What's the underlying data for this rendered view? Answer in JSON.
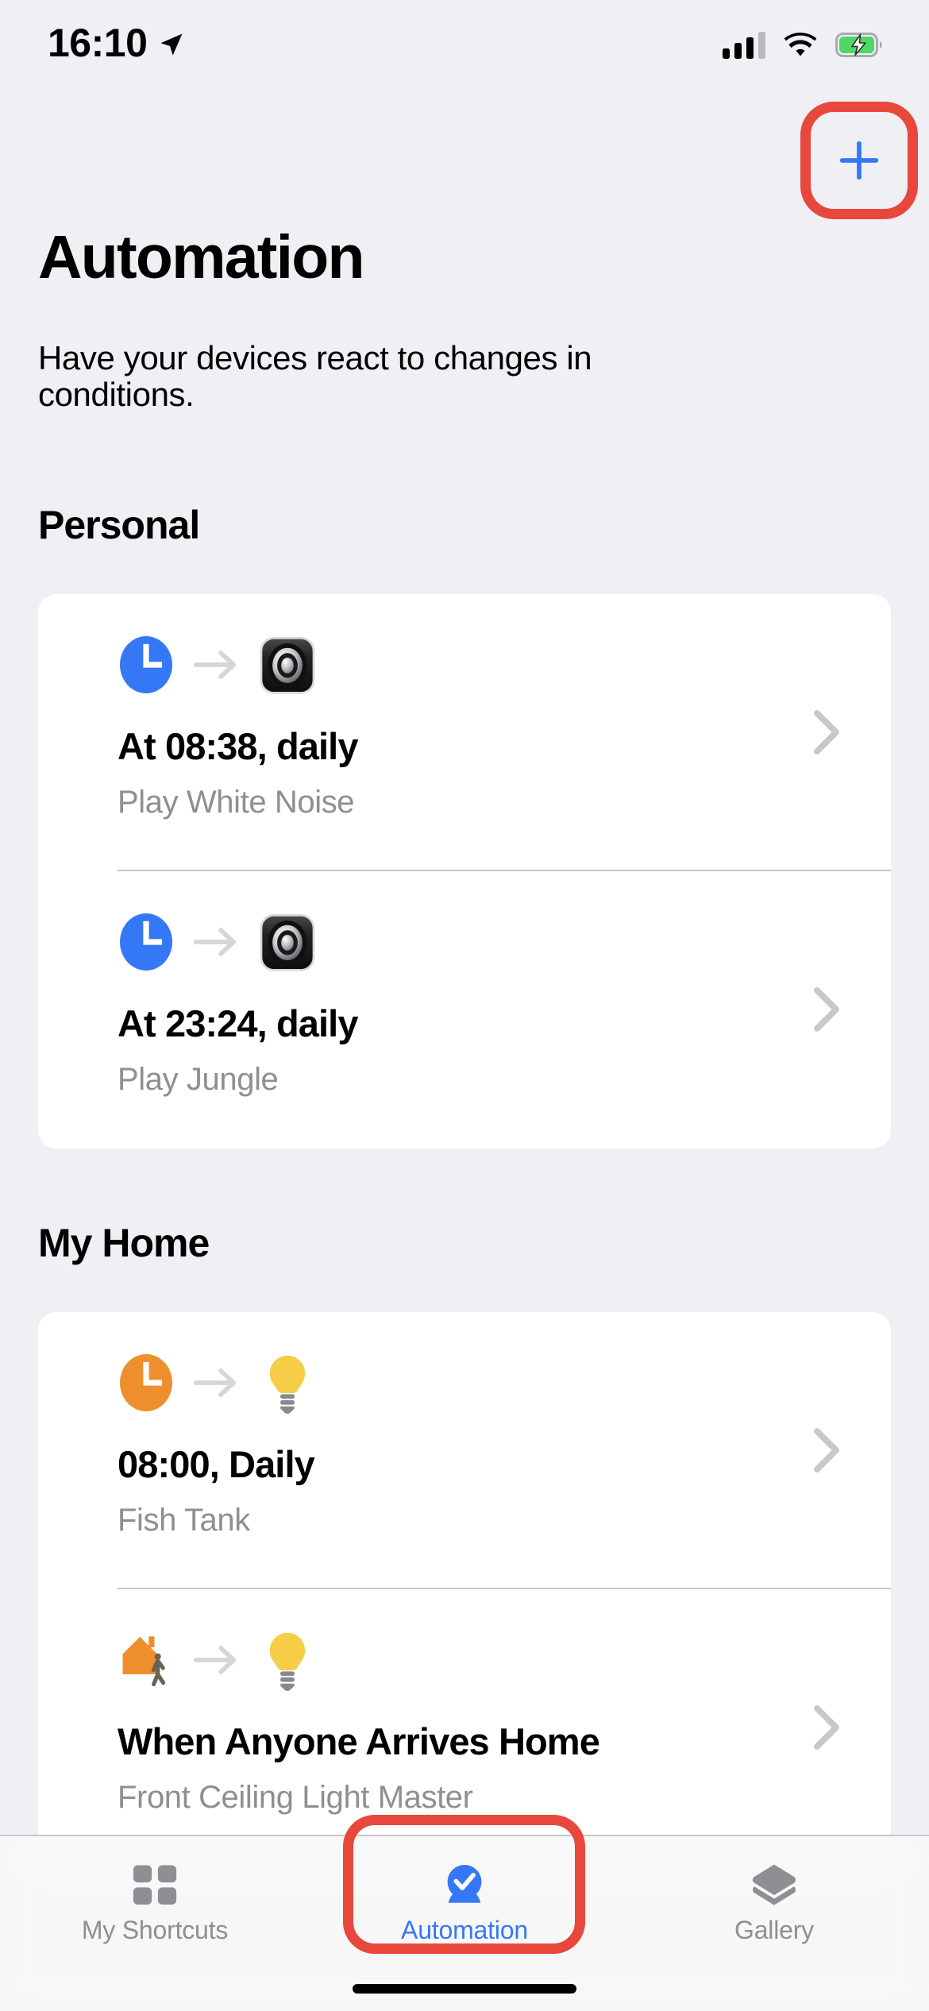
{
  "status_bar": {
    "time": "16:10",
    "location_icon": "location-arrow-icon",
    "cellular_icon": "cellular-bars-icon",
    "wifi_icon": "wifi-icon",
    "battery_icon": "battery-charging-icon",
    "battery_color": "#4cd964"
  },
  "nav": {
    "add_label": "+",
    "add_icon": "plus-icon",
    "accent_color": "#3478f6"
  },
  "header": {
    "title": "Automation",
    "subtitle": "Have your devices react to changes in conditions."
  },
  "sections": [
    {
      "title": "Personal",
      "rows": [
        {
          "trigger_icon": "clock-icon-blue",
          "trigger_color": "#3478f6",
          "action_icon": "speaker-app-icon",
          "title": "At 08:38, daily",
          "subtitle": "Play White Noise",
          "chevron": "chevron-right-icon"
        },
        {
          "trigger_icon": "clock-icon-blue",
          "trigger_color": "#3478f6",
          "action_icon": "speaker-app-icon",
          "title": "At 23:24, daily",
          "subtitle": "Play Jungle",
          "chevron": "chevron-right-icon"
        }
      ]
    },
    {
      "title": "My Home",
      "rows": [
        {
          "trigger_icon": "clock-icon-orange",
          "trigger_color": "#ef8e2d",
          "action_icon": "lightbulb-icon",
          "action_color": "#f6cd46",
          "title": "08:00, Daily",
          "subtitle": "Fish Tank",
          "chevron": "chevron-right-icon"
        },
        {
          "trigger_icon": "home-arrive-icon",
          "trigger_color": "#ef8e2d",
          "action_icon": "lightbulb-icon",
          "action_color": "#f6cd46",
          "title": "When Anyone Arrives Home",
          "subtitle": "Front Ceiling Light Master",
          "chevron": "chevron-right-icon"
        }
      ]
    }
  ],
  "tabbar": {
    "tabs": [
      {
        "label": "My Shortcuts",
        "icon": "grid-squares-icon",
        "active": false
      },
      {
        "label": "Automation",
        "icon": "automation-check-icon",
        "active": true
      },
      {
        "label": "Gallery",
        "icon": "layers-stack-icon",
        "active": false
      }
    ],
    "active_color": "#3478f6",
    "inactive_color": "#8e8e93"
  },
  "annotations": {
    "color": "#e8473c",
    "targets": [
      "add-automation-button",
      "tab-automation"
    ]
  }
}
